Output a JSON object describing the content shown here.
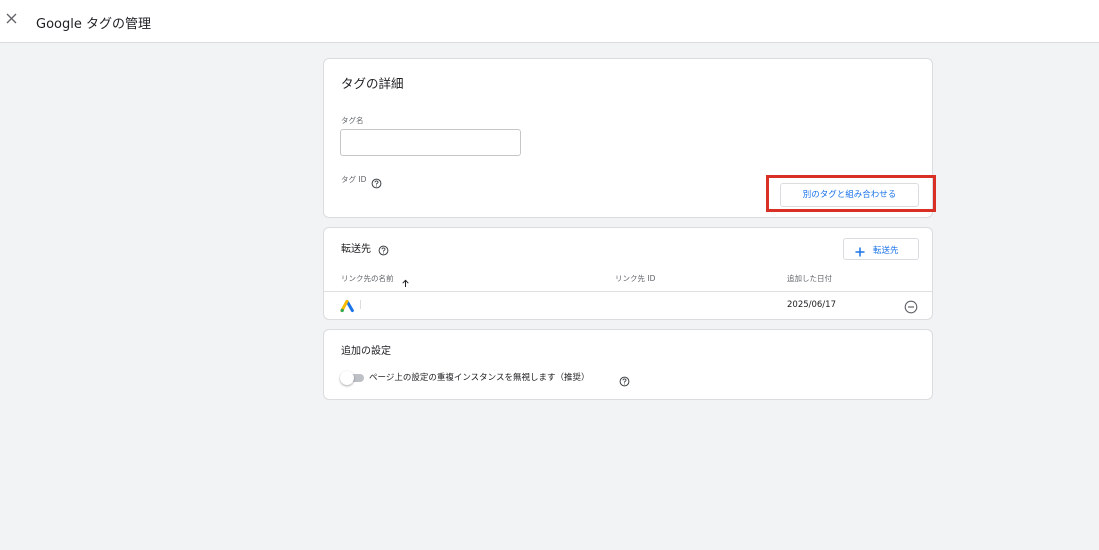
{
  "header": {
    "title": "Google タグの管理",
    "close_icon": "close-icon"
  },
  "tag_details": {
    "title": "タグの詳細",
    "tag_name_label": "タグ名",
    "tag_name_value": "",
    "tag_id_label": "タグ ID",
    "combine_button": "別のタグと組み合わせる"
  },
  "destinations": {
    "title": "転送先",
    "add_button": "転送先",
    "columns": {
      "name": "リンク先の名前",
      "id": "リンク先 ID",
      "date_added": "追加した日付"
    },
    "rows": [
      {
        "icon": "google-ads-icon",
        "name": "",
        "id": "",
        "date_added": "2025/06/17"
      }
    ]
  },
  "additional_settings": {
    "title": "追加の設定",
    "toggle_label": "ページ上の設定の重複インスタンスを無視します（推奨）",
    "toggle_on": false
  },
  "colors": {
    "accent": "#1a73e8",
    "highlight": "#d93025",
    "background": "#f1f3f4"
  }
}
